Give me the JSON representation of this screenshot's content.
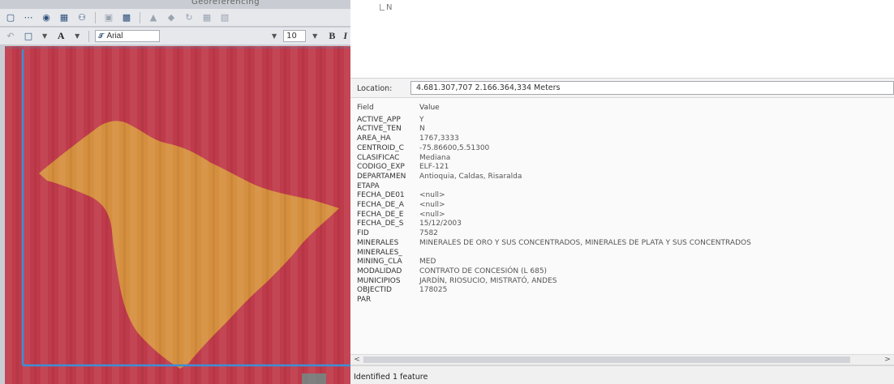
{
  "toolbar": {
    "title": "Georeferencing",
    "font_name": "Arial",
    "font_size": "10",
    "bold_label": "B",
    "italic_label": "I",
    "text_color_label": "A"
  },
  "tree": {
    "item": "N"
  },
  "identify": {
    "location_label": "Location:",
    "location_value": "4.681.307,707  2.166.364,334 Meters",
    "headers": {
      "field": "Field",
      "value": "Value"
    },
    "rows": [
      {
        "field": "ACTIVE_APP",
        "value": "Y"
      },
      {
        "field": "ACTIVE_TEN",
        "value": "N"
      },
      {
        "field": "AREA_HA",
        "value": "1767,3333"
      },
      {
        "field": "CENTROID_C",
        "value": "-75.86600,5.51300"
      },
      {
        "field": "CLASIFICAC",
        "value": "Mediana"
      },
      {
        "field": "CODIGO_EXP",
        "value": "ELF-121"
      },
      {
        "field": "DEPARTAMEN",
        "value": "Antioquia, Caldas, Risaralda"
      },
      {
        "field": "ETAPA",
        "value": ""
      },
      {
        "field": "FECHA_DE01",
        "value": "<null>"
      },
      {
        "field": "FECHA_DE_A",
        "value": "<null>"
      },
      {
        "field": "FECHA_DE_E",
        "value": "<null>"
      },
      {
        "field": "FECHA_DE_S",
        "value": "15/12/2003"
      },
      {
        "field": "FID",
        "value": "7582"
      },
      {
        "field": "MINERALES",
        "value": "MINERALES DE ORO Y SUS CONCENTRADOS, MINERALES DE PLATA Y SUS CONCENTRADOS"
      },
      {
        "field": "MINERALES_",
        "value": ""
      },
      {
        "field": "MINING_CLA",
        "value": "MED"
      },
      {
        "field": "MODALIDAD",
        "value": "CONTRATO DE CONCESIÓN (L 685)"
      },
      {
        "field": "MUNICIPIOS",
        "value": "JARDÍN, RIOSUCIO, MISTRATÓ, ANDES"
      },
      {
        "field": "OBJECTID",
        "value": "178025"
      },
      {
        "field": "PAR",
        "value": ""
      }
    ],
    "status": "Identified 1 feature"
  },
  "colors": {
    "map_red": "#bf3a4a",
    "map_yellow": "#d9a23c",
    "map_blue_line": "#3d8fd6",
    "toolbar_bg": "#e6e8ec"
  },
  "icons": [
    "identify-icon",
    "measure-icon",
    "find-binoculars-icon",
    "go-to-xy-icon",
    "layer-icon",
    "zoom-icon",
    "select-box-icon",
    "text-color-icon"
  ]
}
